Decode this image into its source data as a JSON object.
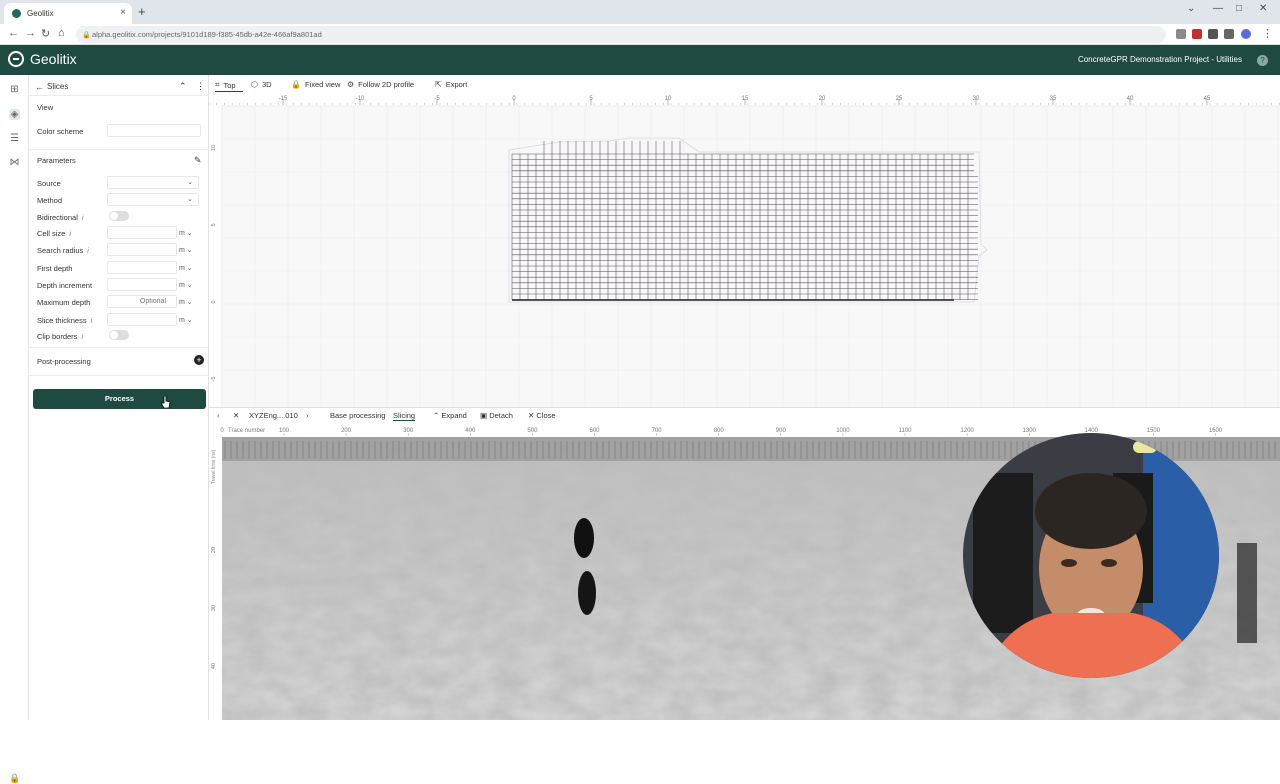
{
  "browser": {
    "tab_title": "Geolitix",
    "url": "alpha.geolitix.com/projects/9101d189-f385-45db-a42e-466af9a801ad"
  },
  "app": {
    "name": "Geolitix",
    "project": "ConcreteGPR Demonstration Project - Utilities"
  },
  "panel": {
    "title": "Slices",
    "view_heading": "View",
    "color_scheme_label": "Color scheme",
    "parameters_heading": "Parameters",
    "fields": [
      {
        "label": "Source"
      },
      {
        "label": "Method"
      },
      {
        "label": "Bidirectional",
        "info": "i"
      },
      {
        "label": "Cell size",
        "info": "i",
        "unit": "m"
      },
      {
        "label": "Search radius",
        "info": "i",
        "unit": "m"
      },
      {
        "label": "First depth",
        "unit": "m"
      },
      {
        "label": "Depth increment",
        "unit": "m"
      },
      {
        "label": "Maximum depth",
        "placeholder": "Optional",
        "unit": "m"
      },
      {
        "label": "Slice thickness",
        "info": "i",
        "unit": "m"
      },
      {
        "label": "Clip borders",
        "info": "i"
      }
    ],
    "post_processing_label": "Post-processing",
    "process_label": "Process"
  },
  "toolbar": {
    "top_label": "Top",
    "three_d_label": "3D",
    "fixed_view_label": "Fixed view",
    "follow_label": "Follow 2D profile",
    "export_label": "Export"
  },
  "map": {
    "x_ticks": [
      "-15",
      "-10",
      "-5",
      "0",
      "5",
      "10",
      "15",
      "20",
      "25",
      "30",
      "35",
      "40",
      "45"
    ],
    "y_ticks": [
      "10",
      "5",
      "0",
      "-5"
    ]
  },
  "bottom": {
    "file_label": "XYZEng....010",
    "tabs": [
      "Base processing",
      "Slicing"
    ],
    "expand_label": "Expand",
    "detach_label": "Detach",
    "close_label": "Close",
    "trace_axis_label": "Trace number",
    "trace_ticks": [
      "100",
      "200",
      "300",
      "400",
      "500",
      "600",
      "700",
      "800",
      "900",
      "1000",
      "1100",
      "1200",
      "1300",
      "1400",
      "1500",
      "1600"
    ],
    "time_axis_label": "Travel time (ns)",
    "time_ticks": [
      "20",
      "30",
      "40"
    ]
  },
  "colors": {
    "brand": "#1f4a42",
    "grid_line": "#5a4a5a"
  },
  "icons": [
    "slices-back-arrow-icon",
    "collapse-chevron-icon",
    "more-vert-icon",
    "wand-icon",
    "add-circle-icon",
    "grid-icon",
    "layers-icon",
    "sliders-icon",
    "share-icon",
    "lock-icon"
  ]
}
